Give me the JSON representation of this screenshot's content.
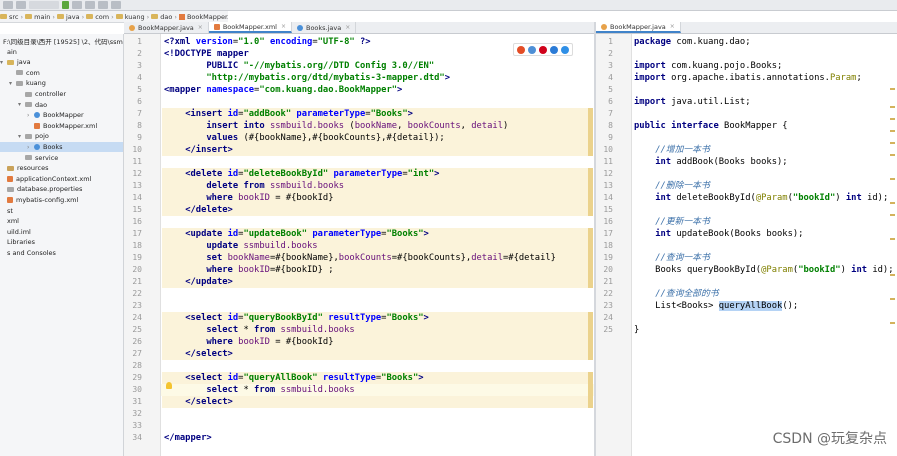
{
  "breadcrumb": [
    "src",
    "main",
    "java",
    "com",
    "kuang",
    "dao",
    "BookMapper.xml"
  ],
  "left_tabs": [
    {
      "label": "BookMapper.java",
      "icon": "java-interface-icon",
      "active": false
    },
    {
      "label": "BookMapper.xml",
      "icon": "xml-file-icon",
      "active": true
    },
    {
      "label": "Books.java",
      "icon": "java-class-icon",
      "active": false
    }
  ],
  "right_tabs": [
    {
      "label": "BookMapper.java",
      "icon": "java-interface-icon",
      "active": true
    }
  ],
  "sidebar": {
    "items": [
      {
        "label": "F:\\同级目录\\西开 [19525] \\2、代码\\ssmbu",
        "indent": 0,
        "icon": "folder-icon",
        "arrow": ""
      },
      {
        "label": "ain",
        "indent": 0,
        "icon": "",
        "arrow": ""
      },
      {
        "label": "java",
        "indent": 0,
        "icon": "folder-icon",
        "arrow": "▾"
      },
      {
        "label": "com",
        "indent": 1,
        "icon": "package-icon",
        "arrow": ""
      },
      {
        "label": "kuang",
        "indent": 1,
        "icon": "package-icon",
        "arrow": "▾"
      },
      {
        "label": "controller",
        "indent": 2,
        "icon": "package-icon",
        "arrow": ""
      },
      {
        "label": "dao",
        "indent": 2,
        "icon": "package-icon",
        "arrow": "▾"
      },
      {
        "label": "BookMapper",
        "indent": 3,
        "icon": "class-icon",
        "arrow": "›"
      },
      {
        "label": "BookMapper.xml",
        "indent": 3,
        "icon": "xml-icon",
        "arrow": ""
      },
      {
        "label": "pojo",
        "indent": 2,
        "icon": "package-icon",
        "arrow": "▾"
      },
      {
        "label": "Books",
        "indent": 3,
        "icon": "class-icon",
        "arrow": "›"
      },
      {
        "label": "service",
        "indent": 2,
        "icon": "package-icon",
        "arrow": ""
      },
      {
        "label": "resources",
        "indent": 0,
        "icon": "resources-folder-icon",
        "arrow": ""
      },
      {
        "label": "applicationContext.xml",
        "indent": 0,
        "icon": "xml-icon",
        "arrow": ""
      },
      {
        "label": "database.properties",
        "indent": 0,
        "icon": "properties-icon",
        "arrow": ""
      },
      {
        "label": "mybatis-config.xml",
        "indent": 0,
        "icon": "xml-icon",
        "arrow": ""
      },
      {
        "label": "st",
        "indent": 0,
        "icon": "",
        "arrow": ""
      },
      {
        "label": "xml",
        "indent": 0,
        "icon": "",
        "arrow": ""
      },
      {
        "label": "uild.iml",
        "indent": 0,
        "icon": "",
        "arrow": ""
      },
      {
        "label": "Libraries",
        "indent": 0,
        "icon": "",
        "arrow": ""
      },
      {
        "label": "s and Consoles",
        "indent": 0,
        "icon": "",
        "arrow": ""
      }
    ],
    "selected_index": 10
  },
  "xml_lines": [
    {
      "n": "1",
      "html": "<span class='tag'>&lt;?xml </span><span class='attr'>version</span>=<span class='val'>\"1.0\"</span> <span class='attr'>encoding</span>=<span class='val'>\"UTF-8\"</span> <span class='tag'>?&gt;</span>"
    },
    {
      "n": "2",
      "html": "<span class='tag'>&lt;!DOCTYPE mapper</span>"
    },
    {
      "n": "3",
      "html": "        <span class='tag'>PUBLIC </span><span class='val'>\"-//mybatis.org//DTD Config 3.0//EN\"</span>"
    },
    {
      "n": "4",
      "html": "        <span class='val'>\"http://mybatis.org/dtd/mybatis-3-mapper.dtd\"</span><span class='tag'>&gt;</span>"
    },
    {
      "n": "5",
      "html": "<span class='tag'>&lt;mapper </span><span class='attr'>namespace</span>=<span class='val'>\"com.kuang.dao.BookMapper\"</span><span class='tag'>&gt;</span>"
    },
    {
      "n": "6",
      "html": ""
    },
    {
      "n": "7",
      "html": "    <span class='tag'>&lt;insert </span><span class='attr'>id</span>=<span class='val'>\"addBook\"</span> <span class='attr'>parameterType</span>=<span class='val'>\"Books\"</span><span class='tag'>&gt;</span>"
    },
    {
      "n": "8",
      "html": "        <span class='sql'>insert into </span><span class='sqlid'>ssmbuild.books</span> (<span class='sqlid'>bookName</span>, <span class='sqlid'>bookCounts</span>, <span class='sqlid'>detail</span>)"
    },
    {
      "n": "9",
      "html": "        <span class='sql'>values </span>(#{bookName},#{bookCounts},#{detail});"
    },
    {
      "n": "10",
      "html": "    <span class='tag'>&lt;/insert&gt;</span>"
    },
    {
      "n": "11",
      "html": ""
    },
    {
      "n": "12",
      "html": "    <span class='tag'>&lt;delete </span><span class='attr'>id</span>=<span class='val'>\"deleteBookById\"</span> <span class='attr'>parameterType</span>=<span class='val'>\"int\"</span><span class='tag'>&gt;</span>"
    },
    {
      "n": "13",
      "html": "        <span class='sql'>delete from </span><span class='sqlid'>ssmbuild.books</span>"
    },
    {
      "n": "14",
      "html": "        <span class='sql'>where </span><span class='sqlid'>bookID</span> = #{bookId}"
    },
    {
      "n": "15",
      "html": "    <span class='tag'>&lt;/delete&gt;</span>"
    },
    {
      "n": "16",
      "html": ""
    },
    {
      "n": "17",
      "html": "    <span class='tag'>&lt;update </span><span class='attr'>id</span>=<span class='val'>\"updateBook\"</span> <span class='attr'>parameterType</span>=<span class='val'>\"Books\"</span><span class='tag'>&gt;</span>"
    },
    {
      "n": "18",
      "html": "        <span class='sql'>update </span><span class='sqlid'>ssmbuild.books</span>"
    },
    {
      "n": "19",
      "html": "        <span class='sql'>set </span><span class='sqlid'>bookName</span>=#{bookName},<span class='sqlid'>bookCounts</span>=#{bookCounts},<span class='sqlid'>detail</span>=#{detail}"
    },
    {
      "n": "20",
      "html": "        <span class='sql'>where </span><span class='sqlid'>bookID</span>=#{bookID} ;"
    },
    {
      "n": "21",
      "html": "    <span class='tag'>&lt;/update&gt;</span>"
    },
    {
      "n": "22",
      "html": ""
    },
    {
      "n": "23",
      "html": ""
    },
    {
      "n": "24",
      "html": "    <span class='tag'>&lt;select </span><span class='attr'>id</span>=<span class='val'>\"queryBookById\"</span> <span class='attr'>resultType</span>=<span class='val'>\"Books\"</span><span class='tag'>&gt;</span>"
    },
    {
      "n": "25",
      "html": "        <span class='sql'>select </span>* <span class='sql'>from </span><span class='sqlid'>ssmbuild.books</span>"
    },
    {
      "n": "26",
      "html": "        <span class='sql'>where </span><span class='sqlid'>bookID</span> = #{bookId}"
    },
    {
      "n": "27",
      "html": "    <span class='tag'>&lt;/select&gt;</span>"
    },
    {
      "n": "28",
      "html": ""
    },
    {
      "n": "29",
      "html": "    <span class='tag'>&lt;select </span><span class='attr'>id</span>=<span class='val'>\"queryAllBook\"</span> <span class='attr'>resultType</span>=<span class='val'>\"Books\"</span><span class='tag'>&gt;</span>"
    },
    {
      "n": "30",
      "html": "        <span class='sql'>select </span>* <span class='sql'>from </span><span class='sqlid'>ssmbuild.books</span>"
    },
    {
      "n": "31",
      "html": "    <span class='tag'>&lt;/select&gt;</span>"
    },
    {
      "n": "32",
      "html": ""
    },
    {
      "n": "33",
      "html": ""
    },
    {
      "n": "34",
      "html": "<span class='tag'>&lt;/mapper&gt;</span>"
    }
  ],
  "java_lines": [
    {
      "n": "1",
      "html": "<span class='kw'>package </span>com.kuang.dao;"
    },
    {
      "n": "2",
      "html": ""
    },
    {
      "n": "3",
      "html": "<span class='kw'>import </span>com.kuang.pojo.Books;"
    },
    {
      "n": "4",
      "html": "<span class='kw'>import </span>org.apache.ibatis.annotations.<span class='ann'>Param</span>;"
    },
    {
      "n": "5",
      "html": ""
    },
    {
      "n": "6",
      "html": "<span class='kw'>import </span>java.util.List;"
    },
    {
      "n": "7",
      "html": ""
    },
    {
      "n": "8",
      "html": "<span class='kw'>public interface </span>BookMapper {"
    },
    {
      "n": "9",
      "html": ""
    },
    {
      "n": "10",
      "html": "    <span class='cmt'>//增加一本书</span>"
    },
    {
      "n": "11",
      "html": "    <span class='kw'>int </span>addBook(Books books);"
    },
    {
      "n": "12",
      "html": ""
    },
    {
      "n": "13",
      "html": "    <span class='cmt'>//删除一本书</span>"
    },
    {
      "n": "14",
      "html": "    <span class='kw'>int </span>deleteBookById(<span class='ann'>@Param</span>(<span class='str'>\"bookId\"</span>) <span class='kw'>int </span>id);"
    },
    {
      "n": "15",
      "html": ""
    },
    {
      "n": "16",
      "html": "    <span class='cmt'>//更新一本书</span>"
    },
    {
      "n": "17",
      "html": "    <span class='kw'>int </span>updateBook(Books books);"
    },
    {
      "n": "18",
      "html": ""
    },
    {
      "n": "19",
      "html": "    <span class='cmt'>//查询一本书</span>"
    },
    {
      "n": "20",
      "html": "    Books queryBookById(<span class='ann'>@Param</span>(<span class='str'>\"bookId\"</span>) <span class='kw'>int </span>id);"
    },
    {
      "n": "21",
      "html": ""
    },
    {
      "n": "22",
      "html": "    <span class='cmt'>//查询全部的书</span>"
    },
    {
      "n": "23",
      "html": "    List&lt;Books&gt; <span class='selword'>queryAllBook</span>();"
    },
    {
      "n": "24",
      "html": ""
    },
    {
      "n": "25",
      "html": "}"
    }
  ],
  "watermark": "CSDN @玩复杂点",
  "colors": {
    "selection": "#c6dbf3",
    "highlight_block": "#fbf3da",
    "accent": "#4083c9"
  }
}
